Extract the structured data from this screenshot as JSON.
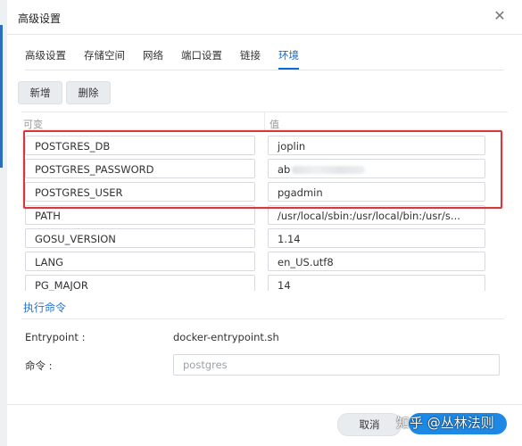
{
  "window": {
    "title": "高级设置"
  },
  "tabs": [
    "高级设置",
    "存储空间",
    "网络",
    "端口设置",
    "链接",
    "环境"
  ],
  "active_tab": "环境",
  "toolbar": {
    "add_label": "新增",
    "delete_label": "删除"
  },
  "table": {
    "headers": {
      "variable": "可变",
      "value": "值"
    },
    "rows": [
      {
        "key": "POSTGRES_DB",
        "value": "joplin"
      },
      {
        "key": "POSTGRES_PASSWORD",
        "value": "ab"
      },
      {
        "key": "POSTGRES_USER",
        "value": "pgadmin"
      },
      {
        "key": "PATH",
        "value": "/usr/local/sbin:/usr/local/bin:/usr/s..."
      },
      {
        "key": "GOSU_VERSION",
        "value": "1.14"
      },
      {
        "key": "LANG",
        "value": "en_US.utf8"
      },
      {
        "key": "PG_MAJOR",
        "value": "14"
      }
    ]
  },
  "execute": {
    "section_label": "执行命令",
    "entrypoint_label": "Entrypoint :",
    "entrypoint_value": "docker-entrypoint.sh",
    "command_label": "命令 :",
    "command_placeholder": "postgres"
  },
  "footer": {
    "cancel_label": "取消"
  },
  "watermark": "知乎 @丛林法则",
  "colors": {
    "accent": "#0b6ad8",
    "highlight_box": "#d23b3b",
    "apply_button": "#1e88e5"
  }
}
